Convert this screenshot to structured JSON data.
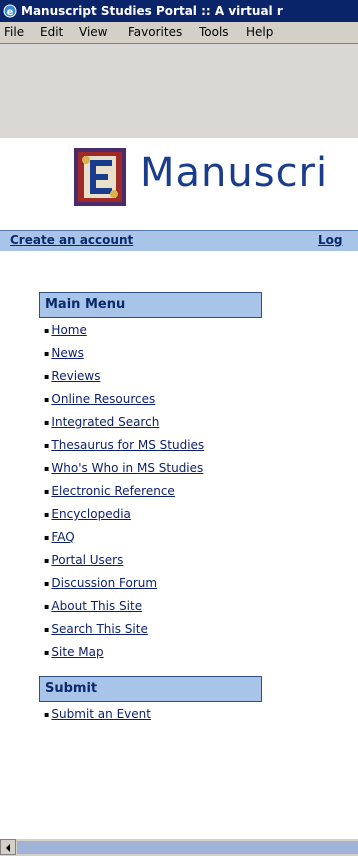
{
  "window": {
    "title": "Manuscript Studies Portal :: A virtual r",
    "menu": [
      "File",
      "Edit",
      "View",
      "Favorites",
      "Tools",
      "Help"
    ]
  },
  "header": {
    "site_title": "Manuscri",
    "nav": [
      {
        "label": "Create an account"
      },
      {
        "label": "Log"
      }
    ]
  },
  "main_menu": {
    "title": "Main Menu",
    "items": [
      "Home",
      "News",
      "Reviews",
      "Online Resources",
      "Integrated Search",
      "Thesaurus for MS Studies",
      "Who's Who in MS Studies",
      "Electronic Reference",
      "Encyclopedia",
      "FAQ",
      "Portal Users",
      "Discussion Forum",
      "About This Site",
      "Search This Site",
      "Site Map"
    ]
  },
  "submit_menu": {
    "title": "Submit",
    "items": [
      "Submit an Event"
    ]
  }
}
